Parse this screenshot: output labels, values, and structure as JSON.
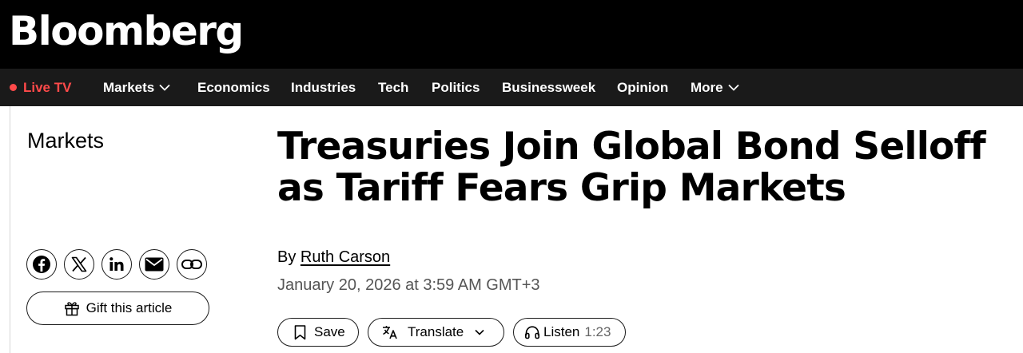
{
  "header": {
    "logo": "Bloomberg"
  },
  "nav": {
    "live_tv": "Live TV",
    "items": [
      "Markets",
      "Economics",
      "Industries",
      "Tech",
      "Politics",
      "Businessweek",
      "Opinion",
      "More"
    ]
  },
  "article": {
    "section": "Markets",
    "headline": "Treasuries Join Global Bond Selloff as Tariff Fears Grip Markets",
    "byline_prefix": "By",
    "author": "Ruth Carson",
    "date": "January 20, 2026 at 3:59 AM GMT+3"
  },
  "share": {
    "icons": [
      "facebook-icon",
      "x-icon",
      "linkedin-icon",
      "email-icon",
      "link-icon"
    ],
    "gift_label": "Gift this article"
  },
  "actions": {
    "save_label": "Save",
    "translate_label": "Translate",
    "listen_label": "Listen",
    "listen_duration": "1:23"
  },
  "colors": {
    "live": "#ff4a4a",
    "nav_bg": "#1a1a1a",
    "top_bg": "#000000"
  }
}
